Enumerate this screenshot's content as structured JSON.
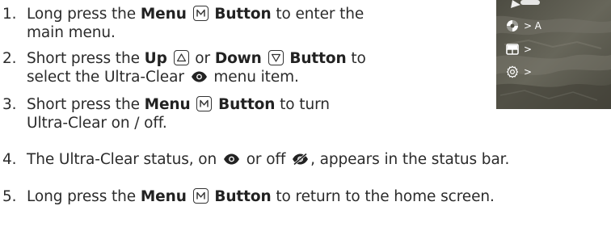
{
  "steps": [
    {
      "number": "1.",
      "lines": [
        {
          "pre": "Long press the ",
          "b1": "Menu",
          "mid": "",
          "b2": "Button",
          "post": " to enter the"
        },
        {
          "text": "main menu."
        }
      ],
      "key_icon": "m-key-icon"
    },
    {
      "number": "2.",
      "lines": [
        {
          "pre": "Short press the ",
          "b1": "Up",
          "mid": " or ",
          "b_down": "Down",
          "b2": "Button",
          "post": " to"
        },
        {
          "pre": "select the Ultra-Clear ",
          "post": " menu item."
        }
      ]
    },
    {
      "number": "3.",
      "lines": [
        {
          "pre": "Short press the ",
          "b1": "Menu",
          "b2": "Button",
          "post": " to turn"
        },
        {
          "text": "Ultra-Clear on / off."
        }
      ]
    },
    {
      "number": "4.",
      "lines": [
        {
          "pre": "The Ultra-Clear status, on ",
          "mid": " or off ",
          "post": ", appears in the status bar."
        }
      ]
    },
    {
      "number": "5.",
      "lines": [
        {
          "pre": "Long press the ",
          "b1": "Menu",
          "b2": "Button",
          "post": " to return to the home screen."
        }
      ]
    }
  ],
  "device_menu": {
    "rows": [
      {
        "icon": "ultra-clear-icon",
        "label": "> A"
      },
      {
        "icon": "layout-icon",
        "label": ">"
      },
      {
        "icon": "gear-icon",
        "label": ">"
      }
    ]
  },
  "colors": {
    "text": "#2b2b2b",
    "device_bg": "#5b5a4e",
    "menu_text": "#ffffff"
  }
}
